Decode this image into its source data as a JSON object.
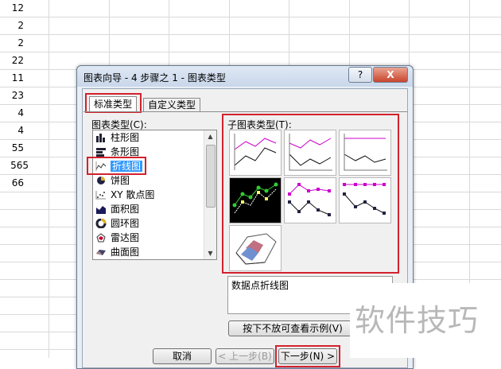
{
  "sheet": {
    "cells": [
      "12",
      "2",
      "2",
      "22",
      "11",
      "23",
      "4",
      "4",
      "55",
      "565",
      "66"
    ]
  },
  "dialog": {
    "title": "图表向导 - 4 步骤之 1 - 图表类型",
    "help_label": "?",
    "close_label": "X",
    "tabs": [
      {
        "label": "标准类型",
        "active": true
      },
      {
        "label": "自定义类型",
        "active": false
      }
    ],
    "chart_type_label": "图表类型(C):",
    "chart_types": [
      {
        "label": "柱形图",
        "icon": "column-chart-icon"
      },
      {
        "label": "条形图",
        "icon": "bar-chart-icon"
      },
      {
        "label": "折线图",
        "icon": "line-chart-icon",
        "selected": true
      },
      {
        "label": "饼图",
        "icon": "pie-chart-icon"
      },
      {
        "label": "XY 散点图",
        "icon": "scatter-chart-icon"
      },
      {
        "label": "面积图",
        "icon": "area-chart-icon"
      },
      {
        "label": "圆环图",
        "icon": "doughnut-chart-icon"
      },
      {
        "label": "雷达图",
        "icon": "radar-chart-icon"
      },
      {
        "label": "曲面图",
        "icon": "surface-chart-icon"
      }
    ],
    "subtype_label": "子图表类型(T):",
    "subtypes": [
      {
        "name": "line",
        "selected": false
      },
      {
        "name": "stacked-line",
        "selected": false
      },
      {
        "name": "percent-stacked-line",
        "selected": false
      },
      {
        "name": "line-with-markers",
        "selected": true
      },
      {
        "name": "stacked-line-with-markers",
        "selected": false
      },
      {
        "name": "percent-stacked-line-with-markers",
        "selected": false
      },
      {
        "name": "3d-line",
        "selected": false
      }
    ],
    "description": "数据点折线图",
    "preview_button": "按下不放可查看示例(V)",
    "cancel_button": "取消",
    "back_button": "< 上一步(B)",
    "next_button": "下一步(N) >"
  },
  "watermark": "软件技巧",
  "colors": {
    "highlight": "#3399ff",
    "annotation_red": "#d2222d",
    "series_magenta": "#cc00cc",
    "series_green": "#33cc33"
  }
}
